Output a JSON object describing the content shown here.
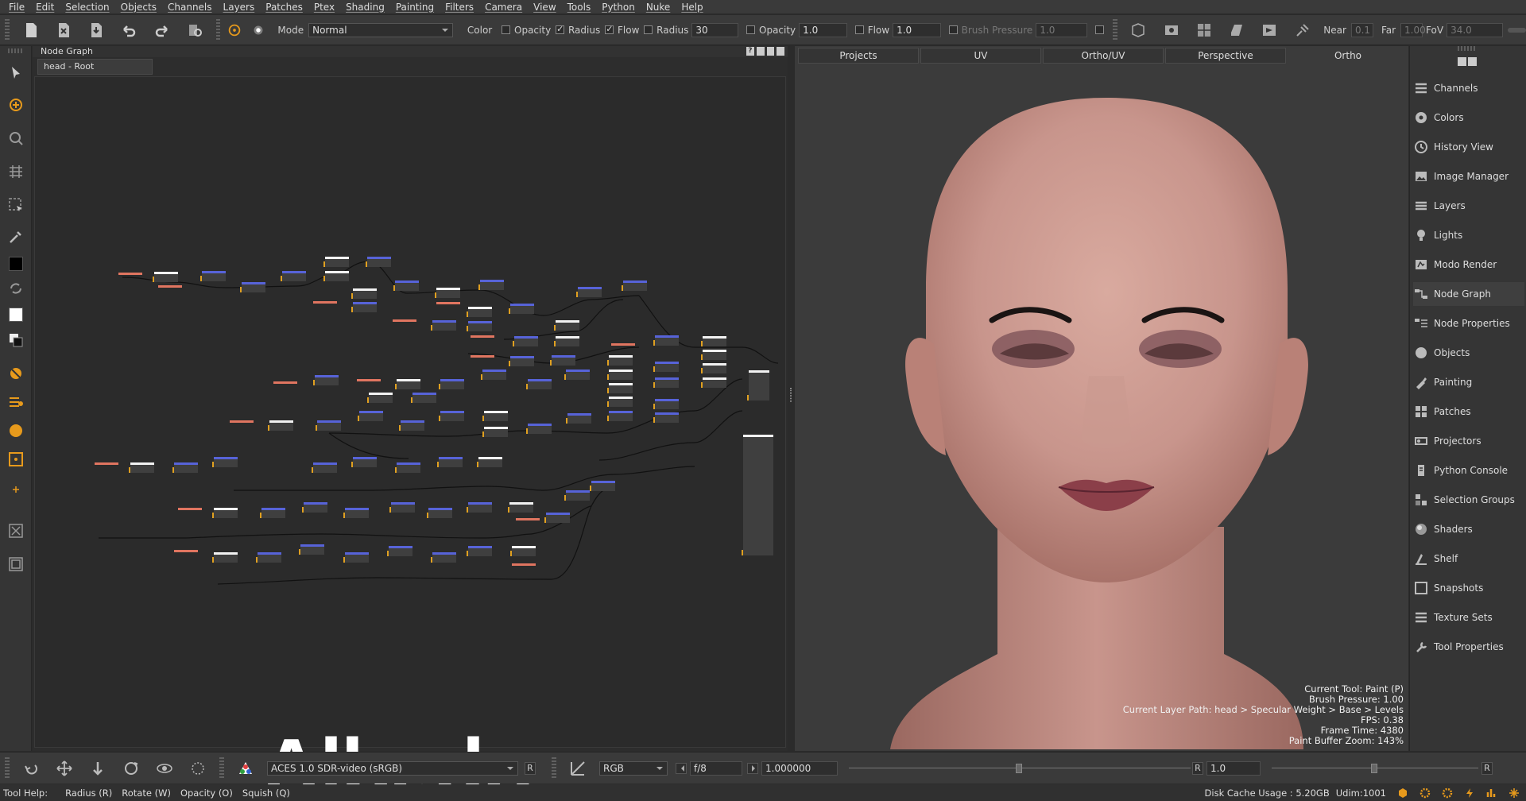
{
  "menu": [
    "File",
    "Edit",
    "Selection",
    "Objects",
    "Channels",
    "Layers",
    "Patches",
    "Ptex",
    "Shading",
    "Painting",
    "Filters",
    "Camera",
    "View",
    "Tools",
    "Python",
    "Nuke",
    "Help"
  ],
  "toolbar": {
    "mode_label": "Mode",
    "mode_value": "Normal",
    "color_label": "Color",
    "opacity_label": "Opacity",
    "radius_label": "Radius",
    "flow_label": "Flow",
    "radius_field_label": "Radius",
    "radius_value": "30",
    "opacity_field_label": "Opacity",
    "opacity_value": "1.0",
    "flow_field_label": "Flow",
    "flow_value": "1.0",
    "brush_pressure_label": "Brush Pressure",
    "brush_pressure_value": "1.0",
    "near_label": "Near",
    "near_value": "0.1",
    "far_label": "Far",
    "far_value": "1.00",
    "fov_label": "FoV",
    "fov_value": "34.0"
  },
  "node_graph": {
    "title": "Node Graph",
    "tab": "head - Root",
    "overlay_text": "Albedo"
  },
  "viewport": {
    "tabs": [
      "Projects",
      "UV",
      "Ortho/UV",
      "Perspective",
      "Ortho"
    ],
    "active_tab": "Ortho",
    "info": [
      "Current Tool: Paint (P)",
      "Brush Pressure: 1.00",
      "Current Layer Path: head > Specular Weight > Base > Levels",
      "FPS: 0.38",
      "Frame Time: 4380",
      "Paint Buffer Zoom: 143%"
    ]
  },
  "right_panel": {
    "items": [
      "Channels",
      "Colors",
      "History View",
      "Image Manager",
      "Layers",
      "Lights",
      "Modo Render",
      "Node Graph",
      "Node Properties",
      "Objects",
      "Painting",
      "Patches",
      "Projectors",
      "Python Console",
      "Selection Groups",
      "Shaders",
      "Shelf",
      "Snapshots",
      "Texture Sets",
      "Tool Properties"
    ],
    "active": "Node Graph"
  },
  "bottom": {
    "colorspace": "ACES 1.0 SDR-video (sRGB)",
    "r_label": "R",
    "channel": "RGB",
    "fstop": "f/8",
    "exposure": "1.000000",
    "r_label2": "R",
    "gamma": "1.0",
    "r_label3": "R"
  },
  "status": {
    "tool_help": "Tool Help:",
    "hints": [
      "Radius (R)",
      "Rotate (W)",
      "Opacity (O)",
      "Squish (Q)"
    ],
    "disk_cache": "Disk Cache Usage : 5.20GB",
    "udim": "Udim:1001"
  },
  "colors": {
    "accent_orange": "#e79a1c",
    "node_blue": "#5763d8",
    "node_red": "#e07560"
  }
}
